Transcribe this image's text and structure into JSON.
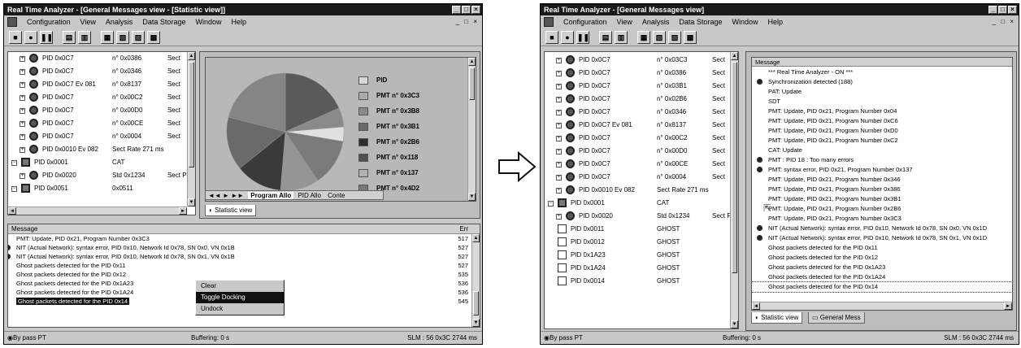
{
  "colors": {
    "titlebar": "#1a1a1a",
    "face": "#c8c8c8",
    "select": "#111111"
  },
  "left": {
    "title": "Real Time Analyzer - [General Messages view - [Statistic view]]",
    "menu": [
      "Configuration",
      "View",
      "Analysis",
      "Data Storage",
      "Window",
      "Help"
    ],
    "tree": [
      {
        "pid": "PID 0x0C7",
        "num": "n° 0x0386",
        "type": "Sect"
      },
      {
        "pid": "PID 0x0C7",
        "num": "n° 0x0346",
        "type": "Sect"
      },
      {
        "pid": "PID 0x0C7 Ev 081",
        "num": "n° 0x8137",
        "type": "Sect"
      },
      {
        "pid": "PID 0x0C7",
        "num": "n° 0x00C2",
        "type": "Sect"
      },
      {
        "pid": "PID 0x0C7",
        "num": "n° 0x00D0",
        "type": "Sect"
      },
      {
        "pid": "PID 0x0C7",
        "num": "n° 0x00CE",
        "type": "Sect"
      },
      {
        "pid": "PID 0x0C7",
        "num": "n° 0x0004",
        "type": "Sect"
      },
      {
        "pid": "PID 0x0010 Ev 082",
        "num": "Sect Rate 271 ms",
        "type": ""
      },
      {
        "pid": "PID 0x0001",
        "num": "CAT",
        "type": ""
      },
      {
        "pid": "PID 0x0020",
        "num": "Std 0x1234",
        "type": "Sect PI"
      },
      {
        "pid": "PID 0x0051",
        "num": "0x0511",
        "type": ""
      }
    ],
    "legend": [
      "PID",
      "PMT n° 0x3C3",
      "PMT n° 0x3B8",
      "PMT n° 0x3B1",
      "PMT n° 0x2B6",
      "PMT n° 0x118",
      "PMT n° 0x137",
      "PMT n° 0x4D2"
    ],
    "pie_tabs": [
      "Program Allo",
      "PID Allo",
      "Conte"
    ],
    "statistic_tab": "Statistic view",
    "msg_header": "Message",
    "msg_col": "Err",
    "messages": [
      {
        "text": "PMT: Update, PID 0x21, Program Number 0x3C3",
        "num": "517",
        "dot": false
      },
      {
        "text": "NIT (Actual Network): syntax error, PID 0x10, Network Id 0x78, SN 0x0, VN 0x1B",
        "num": "527",
        "dot": true
      },
      {
        "text": "NIT (Actual Network): syntax error, PID 0x10, Network Id 0x78, SN 0x1, VN 0x1B",
        "num": "527",
        "dot": true
      },
      {
        "text": "Ghost packets detected for the PID 0x11",
        "num": "527",
        "dot": false
      },
      {
        "text": "Ghost packets detected for the PID 0x12",
        "num": "535",
        "dot": false
      },
      {
        "text": "Ghost packets detected for the PID 0x1A23",
        "num": "536",
        "dot": false
      },
      {
        "text": "Ghost packets detected for the PID 0x1A24",
        "num": "536",
        "dot": false
      },
      {
        "text": "Ghost packets detected for the PID 0x14",
        "num": "545",
        "dot": false
      }
    ],
    "ctx": [
      "Clear",
      "Toggle Docking",
      "Undock"
    ],
    "status": {
      "left": "By pass PT",
      "mid": "Buffering: 0 s",
      "right": "SLM : 56 0x3C 2744 ms"
    }
  },
  "right": {
    "title": "Real Time Analyzer - [General Messages view]",
    "menu": [
      "Configuration",
      "View",
      "Analysis",
      "Data Storage",
      "Window",
      "Help"
    ],
    "tree": [
      {
        "pid": "PID 0x0C7",
        "num": "n° 0x03C3",
        "type": "Sect"
      },
      {
        "pid": "PID 0x0C7",
        "num": "n° 0x0386",
        "type": "Sect"
      },
      {
        "pid": "PID 0x0C7",
        "num": "n° 0x03B1",
        "type": "Sect"
      },
      {
        "pid": "PID 0x0C7",
        "num": "n° 0x02B6",
        "type": "Sect"
      },
      {
        "pid": "PID 0x0C7",
        "num": "n° 0x0346",
        "type": "Sect"
      },
      {
        "pid": "PID 0x0C7 Ev 081",
        "num": "n° 0x8137",
        "type": "Sect"
      },
      {
        "pid": "PID 0x0C7",
        "num": "n° 0x00C2",
        "type": "Sect"
      },
      {
        "pid": "PID 0x0C7",
        "num": "n° 0x00D0",
        "type": "Sect"
      },
      {
        "pid": "PID 0x0C7",
        "num": "n° 0x00CE",
        "type": "Sect"
      },
      {
        "pid": "PID 0x0C7",
        "num": "n° 0x0004",
        "type": "Sect"
      },
      {
        "pid": "PID 0x0010 Ev 082",
        "num": "Sect Rate 271 ms",
        "type": ""
      },
      {
        "pid": "PID 0x0001",
        "num": "CAT",
        "type": ""
      },
      {
        "pid": "PID 0x0020",
        "num": "Std 0x1234",
        "type": "Sect PI"
      },
      {
        "pid": "PID 0x0011",
        "num": "GHOST",
        "type": ""
      },
      {
        "pid": "PID 0x0012",
        "num": "GHOST",
        "type": ""
      },
      {
        "pid": "PID 0x1A23",
        "num": "GHOST",
        "type": ""
      },
      {
        "pid": "PID 0x1A24",
        "num": "GHOST",
        "type": ""
      },
      {
        "pid": "PID 0x0014",
        "num": "GHOST",
        "type": ""
      }
    ],
    "msg_header": "Message",
    "messages": [
      {
        "text": "*** Real Time Analyzer - ON ***",
        "dot": false
      },
      {
        "text": "Synchronization detected (188)",
        "dot": true
      },
      {
        "text": "PAT: Update",
        "dot": false
      },
      {
        "text": "SDT",
        "dot": false
      },
      {
        "text": "PMT: Update, PID 0x21, Program Number 0x04",
        "dot": false
      },
      {
        "text": "PMT: Update, PID 0x21, Program Number 0xC6",
        "dot": false
      },
      {
        "text": "PMT: Update, PID 0x21, Program Number 0xD0",
        "dot": false
      },
      {
        "text": "PMT: Update, PID 0x21, Program Number 0xC2",
        "dot": false
      },
      {
        "text": "CAT: Update",
        "dot": false
      },
      {
        "text": "PMT : PID 18 : Too many errors",
        "dot": true
      },
      {
        "text": "PMT: syntax error, PID 0x21, Program Number 0x137",
        "dot": true
      },
      {
        "text": "PMT: Update, PID 0x21, Program Number 0x346",
        "dot": false
      },
      {
        "text": "PMT: Update, PID 0x21, Program Number 0x386",
        "dot": false
      },
      {
        "text": "PMT: Update, PID 0x21, Program Number 0x3B1",
        "dot": false
      },
      {
        "text": "PMT: Update, PID 0x21, Program Number 0x2B6",
        "dot": false
      },
      {
        "text": "PMT: Update, PID 0x21, Program Number 0x3C3",
        "dot": false
      },
      {
        "text": "NIT (Actual Network): syntax error, PID 0x10, Network Id 0x78, SN 0x0, VN 0x1D",
        "dot": true
      },
      {
        "text": "NIT (Actual Network): syntax error, PID 0x10, Network Id 0x78, SN 0x1, VN 0x1D",
        "dot": true
      },
      {
        "text": "Ghost packets detected for the PID 0x11",
        "dot": false
      },
      {
        "text": "Ghost packets detected for the PID 0x12",
        "dot": false
      },
      {
        "text": "Ghost packets detected for the PID 0x1A23",
        "dot": false
      },
      {
        "text": "Ghost packets detected for the PID 0x1A24",
        "dot": false
      },
      {
        "text": "Ghost packets detected for the PID 0x14",
        "dot": false
      }
    ],
    "tabs": [
      "Statistic view",
      "General Mess"
    ],
    "status": {
      "left": "By pass PT",
      "mid": "Buffering: 0 s",
      "right": "SLM : 56 0x3C 2744 ms"
    }
  }
}
